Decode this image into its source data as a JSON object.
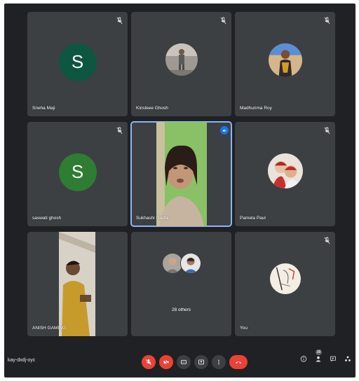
{
  "participants": [
    {
      "name": "Sneha Maji",
      "initial": "S",
      "avatar_color": "#0d5640",
      "type": "letter"
    },
    {
      "name": "Kinsleee Ghosh",
      "type": "photo",
      "photo": "person-standing-photo"
    },
    {
      "name": "Madhurima Roy",
      "type": "photo",
      "photo": "woman-saree-photo"
    },
    {
      "name": "saswati ghosh",
      "initial": "S",
      "avatar_color": "#2e7d32",
      "type": "letter"
    },
    {
      "name": "Sukhashi Gupta",
      "type": "video",
      "speaking": true
    },
    {
      "name": "Pamela Paul",
      "type": "photo",
      "photo": "two-girls-photo"
    },
    {
      "name": "ANISH GAMING",
      "type": "video"
    },
    {
      "others_label": "28 others",
      "type": "others"
    },
    {
      "name": "You",
      "type": "photo",
      "photo": "sketch-photo"
    }
  ],
  "bottom_bar": {
    "meeting_code": "kay-dxdj-oyc",
    "participant_count": "38"
  },
  "colors": {
    "background": "#202124",
    "tile": "#3c4043",
    "accent": "#8ab4f8",
    "danger": "#ea4335"
  },
  "icons": {
    "mic_off": "mic-off-icon",
    "video_off": "video-off-icon",
    "captions": "captions-icon",
    "present": "present-icon",
    "more": "more-vert-icon",
    "hang_up": "hang-up-icon",
    "info": "info-icon",
    "people": "people-icon",
    "chat": "chat-icon",
    "activities": "activities-icon"
  }
}
